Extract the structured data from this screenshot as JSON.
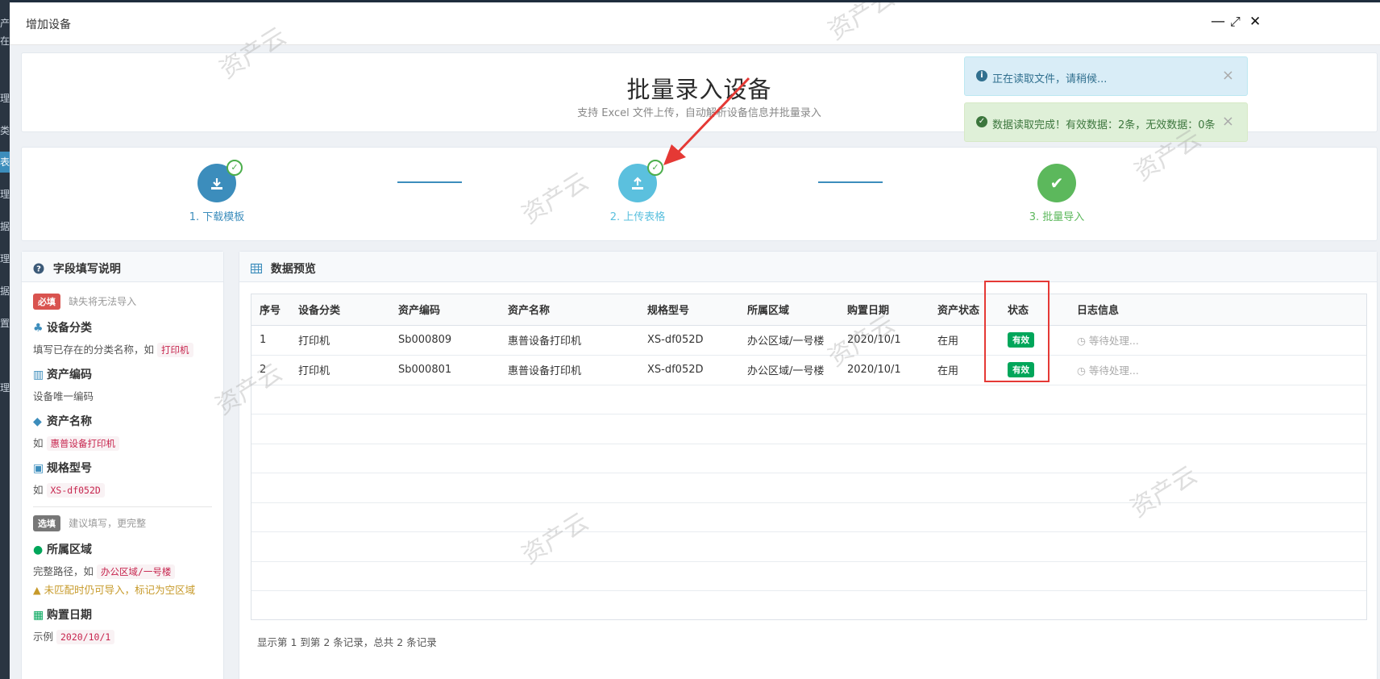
{
  "background": {
    "sidebar_fragments": [
      "产",
      "在",
      "理",
      "类",
      "表",
      "理",
      "据",
      "理",
      "据",
      "置",
      "理"
    ]
  },
  "modal": {
    "title": "增加设备",
    "controls": {
      "minimize": "—",
      "maximize": "⤢",
      "close": "✕"
    }
  },
  "hero": {
    "title": "批量录入设备",
    "subtitle": "支持 Excel 文件上传，自动解析设备信息并批量录入"
  },
  "steps": [
    {
      "label": "1. 下载模板",
      "icon": "download-icon",
      "color": "#3c8dbc",
      "done": true
    },
    {
      "label": "2. 上传表格",
      "icon": "upload-icon",
      "color": "#5bc0de",
      "done": true
    },
    {
      "label": "3. 批量导入",
      "icon": "check-icon",
      "color": "#5cb85c",
      "done": false
    }
  ],
  "field_help": {
    "title": "字段填写说明",
    "required_tag": "必填",
    "required_hint": "缺失将无法导入",
    "optional_tag": "选填",
    "optional_hint": "建议填写，更完整",
    "fields": {
      "category": {
        "title": "设备分类",
        "desc": "填写已存在的分类名称，如",
        "example": "打印机"
      },
      "code": {
        "title": "资产编码",
        "desc": "设备唯一编码"
      },
      "name": {
        "title": "资产名称",
        "desc": "如",
        "example": "惠普设备打印机"
      },
      "model": {
        "title": "规格型号",
        "desc": "如",
        "example": "XS-df052D"
      },
      "area": {
        "title": "所属区域",
        "desc": "完整路径，如",
        "example": "办公区域/一号楼",
        "warning": "未匹配时仍可导入，标记为空区域"
      },
      "date": {
        "title": "购置日期",
        "desc": "示例",
        "example": "2020/10/1"
      }
    }
  },
  "preview": {
    "title": "数据预览",
    "columns": [
      "序号",
      "设备分类",
      "资产编码",
      "资产名称",
      "规格型号",
      "所属区域",
      "购置日期",
      "资产状态",
      "状态",
      "日志信息"
    ],
    "rows": [
      [
        "1",
        "打印机",
        "Sb000809",
        "惠普设备打印机",
        "XS-df052D",
        "办公区域/一号楼",
        "2020/10/1",
        "在用",
        "有效",
        "等待处理..."
      ],
      [
        "2",
        "打印机",
        "Sb000801",
        "惠普设备打印机",
        "XS-df052D",
        "办公区域/一号楼",
        "2020/10/1",
        "在用",
        "有效",
        "等待处理..."
      ]
    ],
    "footer": "显示第 1 到第 2 条记录，总共 2 条记录"
  },
  "toasts": [
    {
      "text": "正在读取文件，请稍候...",
      "type": "info"
    },
    {
      "text": "数据读取完成！有效数据：2条，无效数据：0条",
      "type": "success"
    }
  ],
  "watermark": "资产云"
}
